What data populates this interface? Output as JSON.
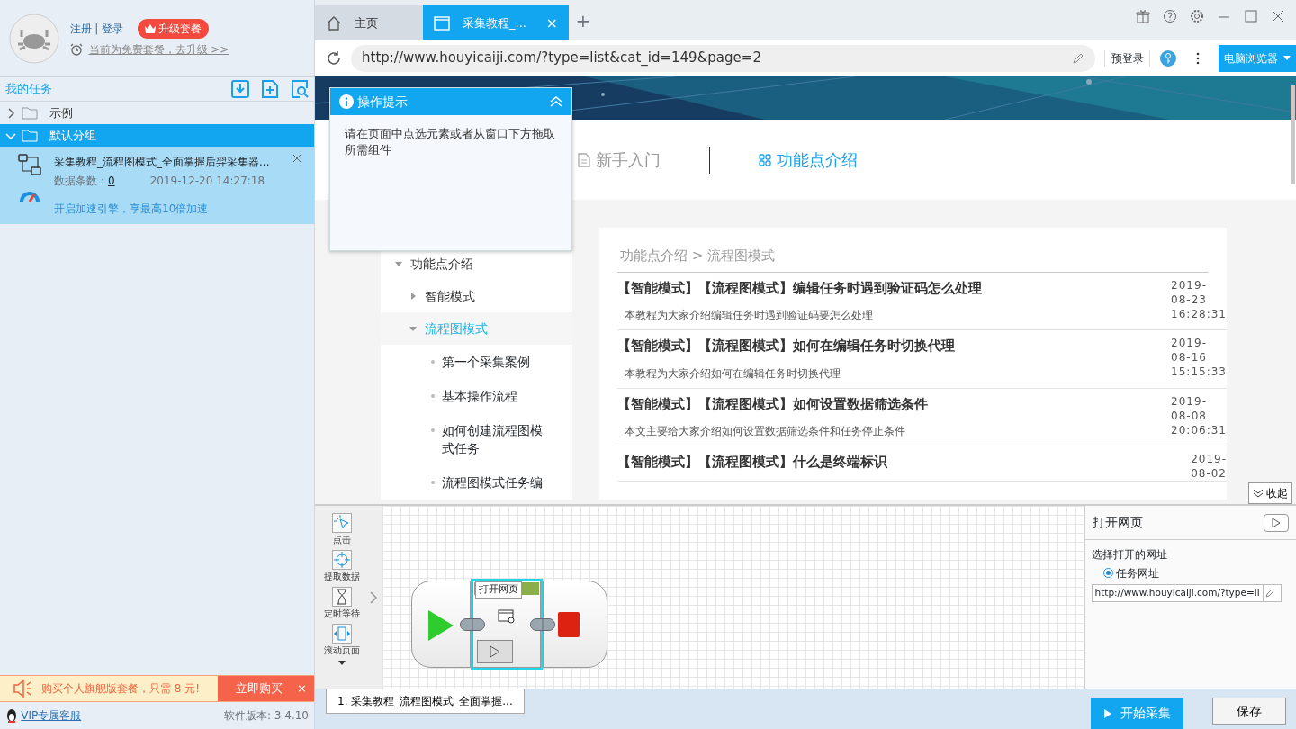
{
  "account": {
    "links": [
      "注册",
      "登录"
    ],
    "separator": "|",
    "upgrade_button": "升级套餐",
    "plan_note": "当前为免费套餐，去升级 >>"
  },
  "tasks": {
    "title": "我的任务",
    "groups": [
      {
        "label": "示例",
        "expanded": false,
        "selected": false
      },
      {
        "label": "默认分组",
        "expanded": true,
        "selected": true,
        "tasks": [
          {
            "name": "采集教程_流程图模式_全面掌握后羿采集器...",
            "count_label": "数据条数：",
            "count": "0",
            "time": "2019-12-20 14:27:18",
            "boost": "开启加速引擎，享最高10倍加速"
          }
        ]
      }
    ]
  },
  "promo": {
    "text": "购买个人旗舰版套餐，只需 8 元!",
    "button": "立即购买",
    "close": "×"
  },
  "footer": {
    "support_link": "VIP专属客服",
    "version": "软件版本: 3.4.10"
  },
  "browser": {
    "tabs": [
      {
        "kind": "home",
        "label": "主页",
        "selected": false
      },
      {
        "kind": "page",
        "label": "采集教程_...",
        "selected": true,
        "close": "×"
      }
    ],
    "new_tab": "+",
    "url": "http://www.houyicaiji.com/?type=list&cat_id=149&page=2",
    "prelogin": "预登录",
    "mode_button": "电脑浏览器"
  },
  "page": {
    "nav": [
      {
        "kind": "doc",
        "label": "新手入门",
        "selected": false
      },
      {
        "kind": "grid",
        "label": "功能点介绍",
        "selected": true
      }
    ],
    "menu": [
      {
        "label": "功能点介绍",
        "expanded": true,
        "selected": false,
        "children": [
          {
            "label": "智能模式",
            "expanded": false,
            "selected": false
          },
          {
            "label": "流程图模式",
            "expanded": true,
            "selected": true,
            "children": [
              {
                "label": "第一个采集案例"
              },
              {
                "label": "基本操作流程"
              },
              {
                "label": "如何创建流程图模式任务"
              },
              {
                "label": "流程图模式任务编"
              }
            ]
          }
        ]
      }
    ],
    "breadcrumb": "功能点介绍 > 流程图模式",
    "articles": [
      {
        "title": "【智能模式】【流程图模式】编辑任务时遇到验证码怎么处理",
        "summary": "本教程为大家介绍编辑任务时遇到验证码要怎么处理",
        "date_lines": [
          "2019-",
          "08-23",
          "16:28:31"
        ]
      },
      {
        "title": "【智能模式】【流程图模式】如何在编辑任务时切换代理",
        "summary": "本教程为大家介绍如何在编辑任务时切换代理",
        "date_lines": [
          "2019-",
          "08-16",
          "15:15:33"
        ]
      },
      {
        "title": "【智能模式】【流程图模式】如何设置数据筛选条件",
        "summary": "本文主要给大家介绍如何设置数据筛选条件和任务停止条件",
        "date_lines": [
          "2019-",
          "08-08",
          "20:06:31"
        ]
      },
      {
        "title": "【智能模式】【流程图模式】什么是终端标识",
        "date_lines": [
          "2019-",
          "08-02"
        ]
      }
    ]
  },
  "tip": {
    "title": "操作提示",
    "body": "请在页面中点选元素或者从窗口下方拖取所需组件"
  },
  "collapse_button": "收起",
  "designer": {
    "toolbox": [
      {
        "kind": "click",
        "label": "点击"
      },
      {
        "kind": "extract",
        "label": "提取数据"
      },
      {
        "kind": "wait",
        "label": "定时等待"
      },
      {
        "kind": "scroll",
        "label": "滚动页面"
      }
    ],
    "nodes": [
      {
        "kind": "start"
      },
      {
        "kind": "step",
        "label": "打开网页",
        "selected": true
      },
      {
        "kind": "end"
      }
    ],
    "properties": {
      "title": "打开网页",
      "field_label": "选择打开的网址",
      "options": [
        {
          "label": "任务网址",
          "selected": true
        }
      ],
      "url_value": "http://www.houyicaiji.com/?type=li"
    }
  },
  "task_tabs": [
    {
      "label": "1. 采集教程_流程图模式_全面掌握...",
      "selected": true
    }
  ],
  "actions": {
    "start": "开始采集",
    "save": "保存"
  }
}
